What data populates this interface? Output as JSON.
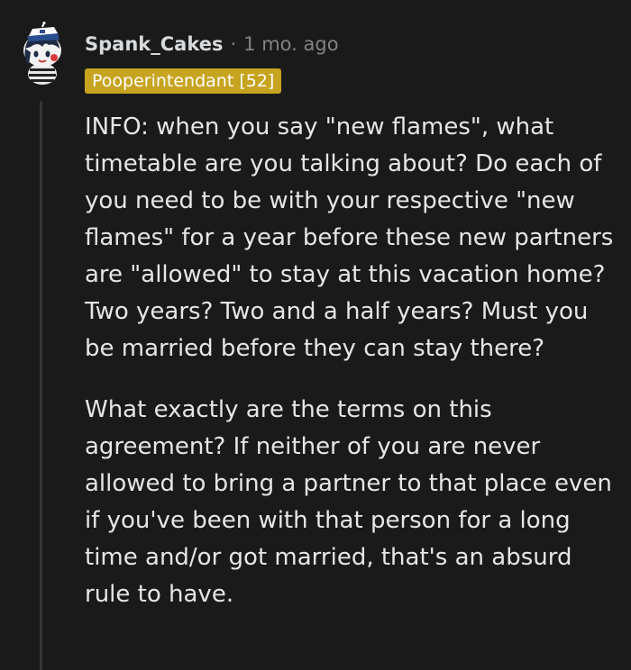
{
  "comment": {
    "username": "Spank_Cakes",
    "separator": "·",
    "timestamp": "1 mo. ago",
    "flair": "Pooperintendant [52]",
    "paragraphs": [
      "INFO: when you say \"new flames\", what timetable are you talking about? Do each of you need to be with your respective \"new flames\" for a year before these new partners are \"allowed\" to stay at this vacation home? Two years? Two and a half years? Must you be married before they can stay there?",
      "What exactly are the terms on this agreement? If neither of you are never allowed to bring a partner to that place even if you've been with that person for a long time and/or got married, that's an absurd rule to have."
    ]
  },
  "colors": {
    "background": "#1a1a1b",
    "text": "#e4e6e8",
    "meta": "#818384",
    "flair_bg": "#c7a41f",
    "thread_line": "#343536"
  },
  "icons": {
    "avatar": "snoo-sailor-avatar-icon"
  }
}
